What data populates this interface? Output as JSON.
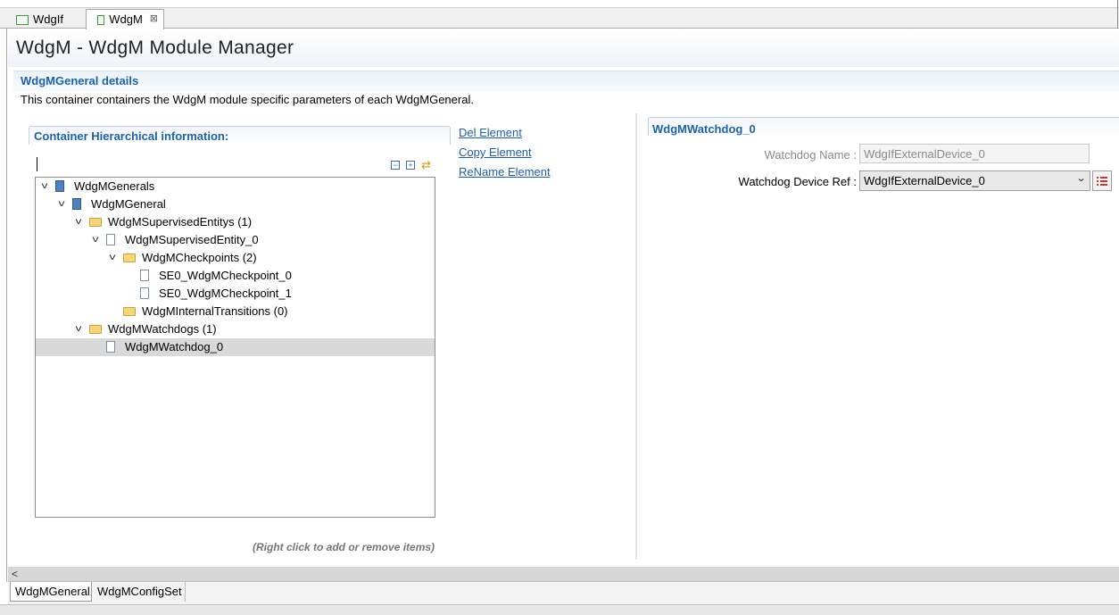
{
  "editor_tabs": [
    {
      "label": "WdgIf",
      "active": false
    },
    {
      "label": "WdgM",
      "active": true,
      "close": "⊠"
    }
  ],
  "page_title": "WdgM - WdgM Module Manager",
  "section": {
    "title": "WdgMGeneral details",
    "description": "This container containers the WdgM module specific parameters of each WdgMGeneral."
  },
  "hierarchy": {
    "title": "Container Hierarchical information:",
    "toolbar": {
      "collapse_icon": "collapse-all-icon",
      "expand_icon": "expand-all-icon",
      "link_icon": "link-editor-icon"
    },
    "tree": [
      {
        "label": "WdgMGenerals",
        "icon": "module",
        "depth": 0,
        "expanded": true
      },
      {
        "label": "WdgMGeneral",
        "icon": "module",
        "depth": 1,
        "expanded": true
      },
      {
        "label": "WdgMSupervisedEntitys (1)",
        "icon": "folder",
        "depth": 2,
        "expanded": true
      },
      {
        "label": "WdgMSupervisedEntity_0",
        "icon": "doc",
        "depth": 3,
        "expanded": true
      },
      {
        "label": "WdgMCheckpoints (2)",
        "icon": "folder",
        "depth": 4,
        "expanded": true
      },
      {
        "label": "SE0_WdgMCheckpoint_0",
        "icon": "doc",
        "depth": 5,
        "expanded": null
      },
      {
        "label": "SE0_WdgMCheckpoint_1",
        "icon": "doc",
        "depth": 5,
        "expanded": null
      },
      {
        "label": "WdgMInternalTransitions (0)",
        "icon": "folder",
        "depth": 4,
        "expanded": null
      },
      {
        "label": "WdgMWatchdogs (1)",
        "icon": "folder",
        "depth": 2,
        "expanded": true
      },
      {
        "label": "WdgMWatchdog_0",
        "icon": "doc",
        "depth": 3,
        "expanded": null,
        "selected": true
      }
    ],
    "hint": "(Right click to add or remove items)"
  },
  "actions": {
    "del": "Del Element",
    "copy": "Copy Element",
    "rename": "ReName Element"
  },
  "detail": {
    "title": "WdgMWatchdog_0",
    "name_label": "Watchdog Name :",
    "name_value": "WdgIfExternalDevice_0",
    "ref_label": "Watchdog Device Ref :",
    "ref_value": "WdgIfExternalDevice_0"
  },
  "bottom_tabs": [
    {
      "label": "WdgMGeneral",
      "active": true
    },
    {
      "label": "WdgMConfigSet",
      "active": false
    }
  ],
  "scroll_arrow": "<"
}
